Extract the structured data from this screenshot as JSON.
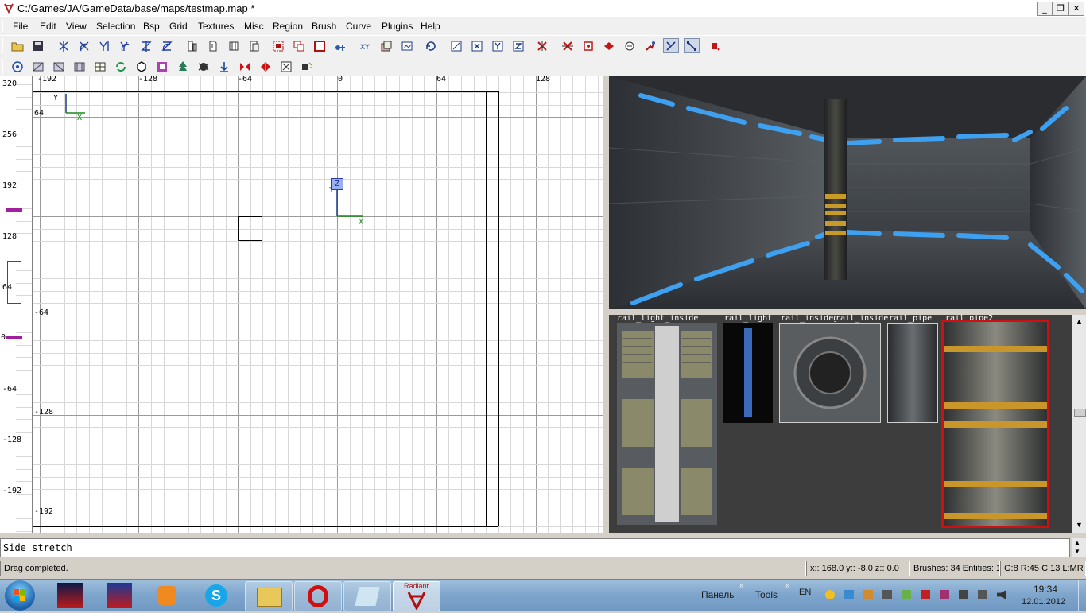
{
  "window": {
    "title": "C:/Games/JA/GameData/base/maps/testmap.map *"
  },
  "menubar": [
    "File",
    "Edit",
    "View",
    "Selection",
    "Bsp",
    "Grid",
    "Textures",
    "Misc",
    "Region",
    "Brush",
    "Curve",
    "Plugins",
    "Help"
  ],
  "xy_view": {
    "top_ruler": [
      "-192",
      "-128",
      "-64",
      "0",
      "64",
      "128"
    ],
    "left_ruler": [
      "64",
      "-64",
      "-128",
      "-192"
    ],
    "axis_labels": {
      "y": "Y",
      "x": "X",
      "z": "Z",
      "origin_x": "X",
      "origin_y": "Y"
    }
  },
  "z_view": {
    "ruler": [
      "320",
      "256",
      "192",
      "0",
      "128",
      "64",
      "0",
      "-64",
      "-128",
      "-192"
    ]
  },
  "texture_browser": {
    "textures": [
      "rail_light_inside",
      "rail_light",
      "rail_insideg",
      "rail_inside_r",
      "rail_pipe",
      "rail_pipe2"
    ],
    "selected": "rail_pipe2"
  },
  "console": {
    "text": "Side stretch"
  },
  "statusbar": {
    "message": "Drag completed.",
    "coords": "x:: 168.0  y:: -8.0  z:: 0.0",
    "counts": "Brushes: 34 Entities: 1",
    "grid": "G:8 R:45 C:13 L:MR"
  },
  "taskbar": {
    "tray_panel": "Панель",
    "tray_tools": "Tools",
    "lang": "EN",
    "time": "19:34",
    "date": "12.01.2012",
    "radiant_label": "Radiant"
  },
  "colors": {
    "accent": "#3070c8",
    "selected_border": "#d01010",
    "grid_major": "#9a9a9a",
    "grid_minor": "#d8d8d8"
  }
}
